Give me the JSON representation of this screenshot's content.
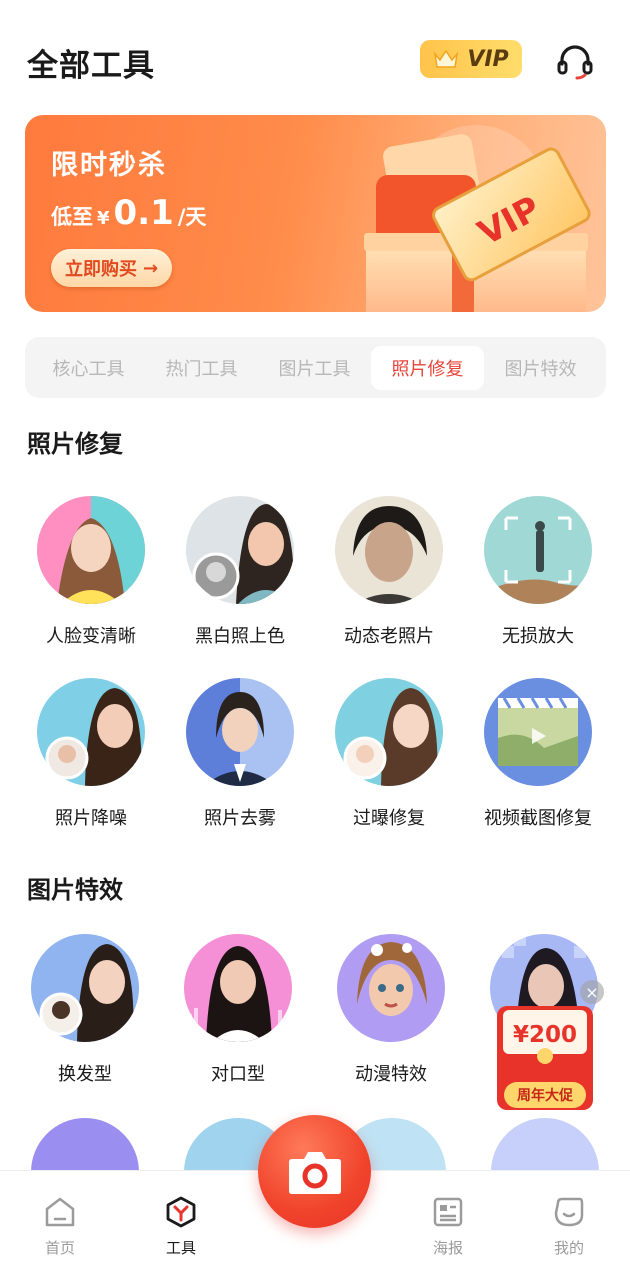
{
  "header": {
    "title": "全部工具",
    "vip_label": "VIP"
  },
  "banner": {
    "title": "限时秒杀",
    "price_prefix": "低至",
    "currency": "¥",
    "price": "0.1",
    "price_suffix": "/天",
    "buy_label": "立即购买",
    "art_text": "VIP"
  },
  "tabs": [
    {
      "label": "核心工具",
      "active": false
    },
    {
      "label": "热门工具",
      "active": false
    },
    {
      "label": "图片工具",
      "active": false
    },
    {
      "label": "照片修复",
      "active": true
    },
    {
      "label": "图片特效",
      "active": false
    }
  ],
  "sections": {
    "photo_repair": {
      "title": "照片修复",
      "items": [
        {
          "label": "人脸变清晰"
        },
        {
          "label": "黑白照上色"
        },
        {
          "label": "动态老照片"
        },
        {
          "label": "无损放大"
        },
        {
          "label": "照片降噪"
        },
        {
          "label": "照片去雾"
        },
        {
          "label": "过曝修复"
        },
        {
          "label": "视频截图修复"
        }
      ]
    },
    "photo_effects": {
      "title": "图片特效",
      "items": [
        {
          "label": "换发型"
        },
        {
          "label": "对口型"
        },
        {
          "label": "动漫特效"
        }
      ]
    }
  },
  "promo": {
    "amount": "¥200",
    "tag": "周年大促"
  },
  "bottom_nav": {
    "home": "首页",
    "tools": "工具",
    "poster": "海报",
    "mine": "我的"
  },
  "colors": {
    "accent": "#e8443a",
    "banner": "#ff7a3d",
    "vip": "#ffc34a"
  }
}
